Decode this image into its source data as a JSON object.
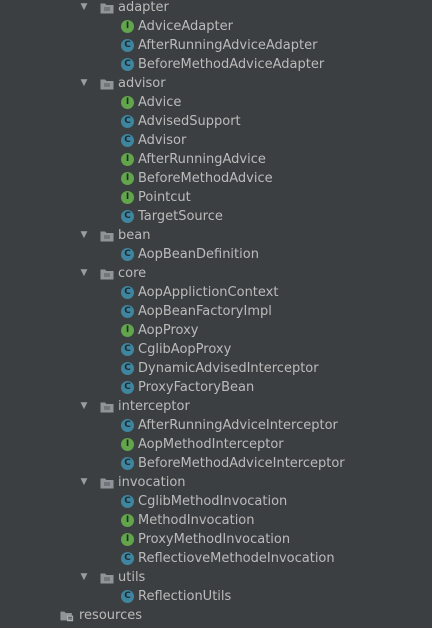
{
  "colors": {
    "background": "#3c3f41",
    "text": "#bbbbbb",
    "class_badge": "#3e86a0",
    "interface_badge": "#62a54a",
    "folder": "#8f9499"
  },
  "tree": [
    {
      "kind": "folder",
      "level": 0,
      "expanded": true,
      "label": "adapter",
      "icon": "package-folder-icon"
    },
    {
      "kind": "interface",
      "level": 1,
      "label": "AdviceAdapter",
      "badge": "I"
    },
    {
      "kind": "class",
      "level": 1,
      "label": "AfterRunningAdviceAdapter",
      "badge": "C"
    },
    {
      "kind": "class",
      "level": 1,
      "label": "BeforeMethodAdviceAdapter",
      "badge": "C"
    },
    {
      "kind": "folder",
      "level": 0,
      "expanded": true,
      "label": "advisor",
      "icon": "package-folder-icon"
    },
    {
      "kind": "interface",
      "level": 1,
      "label": "Advice",
      "badge": "I"
    },
    {
      "kind": "class",
      "level": 1,
      "label": "AdvisedSupport",
      "badge": "C"
    },
    {
      "kind": "class",
      "level": 1,
      "label": "Advisor",
      "badge": "C"
    },
    {
      "kind": "interface",
      "level": 1,
      "label": "AfterRunningAdvice",
      "badge": "I"
    },
    {
      "kind": "interface",
      "level": 1,
      "label": "BeforeMethodAdvice",
      "badge": "I"
    },
    {
      "kind": "interface",
      "level": 1,
      "label": "Pointcut",
      "badge": "I"
    },
    {
      "kind": "class",
      "level": 1,
      "label": "TargetSource",
      "badge": "C"
    },
    {
      "kind": "folder",
      "level": 0,
      "expanded": true,
      "label": "bean",
      "icon": "package-folder-icon"
    },
    {
      "kind": "class",
      "level": 1,
      "label": "AopBeanDefinition",
      "badge": "C"
    },
    {
      "kind": "folder",
      "level": 0,
      "expanded": true,
      "label": "core",
      "icon": "package-folder-icon"
    },
    {
      "kind": "class",
      "level": 1,
      "label": "AopApplictionContext",
      "badge": "C"
    },
    {
      "kind": "class",
      "level": 1,
      "label": "AopBeanFactoryImpl",
      "badge": "C"
    },
    {
      "kind": "interface",
      "level": 1,
      "label": "AopProxy",
      "badge": "I"
    },
    {
      "kind": "class",
      "level": 1,
      "label": "CglibAopProxy",
      "badge": "C"
    },
    {
      "kind": "class",
      "level": 1,
      "label": "DynamicAdvisedInterceptor",
      "badge": "C"
    },
    {
      "kind": "class",
      "level": 1,
      "label": "ProxyFactoryBean",
      "badge": "C"
    },
    {
      "kind": "folder",
      "level": 0,
      "expanded": true,
      "label": "interceptor",
      "icon": "package-folder-icon"
    },
    {
      "kind": "class",
      "level": 1,
      "label": "AfterRunningAdviceInterceptor",
      "badge": "C"
    },
    {
      "kind": "interface",
      "level": 1,
      "label": "AopMethodInterceptor",
      "badge": "I"
    },
    {
      "kind": "class",
      "level": 1,
      "label": "BeforeMethodAdviceInterceptor",
      "badge": "C"
    },
    {
      "kind": "folder",
      "level": 0,
      "expanded": true,
      "label": "invocation",
      "icon": "package-folder-icon"
    },
    {
      "kind": "class",
      "level": 1,
      "label": "CglibMethodInvocation",
      "badge": "C"
    },
    {
      "kind": "interface",
      "level": 1,
      "label": "MethodInvocation",
      "badge": "I"
    },
    {
      "kind": "interface",
      "level": 1,
      "label": "ProxyMethodInvocation",
      "badge": "I"
    },
    {
      "kind": "class",
      "level": 1,
      "label": "ReflectioveMethodeInvocation",
      "badge": "C"
    },
    {
      "kind": "folder",
      "level": 0,
      "expanded": true,
      "label": "utils",
      "icon": "package-folder-icon"
    },
    {
      "kind": "class",
      "level": 1,
      "label": "ReflectionUtils",
      "badge": "C"
    },
    {
      "kind": "resources",
      "level": -1,
      "label": "resources",
      "icon": "resources-folder-icon"
    }
  ]
}
